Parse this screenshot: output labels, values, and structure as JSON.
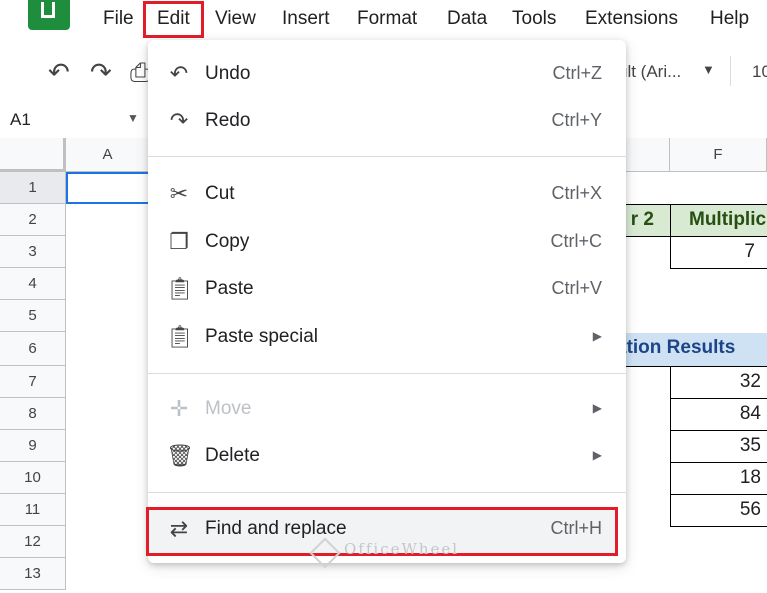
{
  "menubar": {
    "items": [
      "File",
      "Edit",
      "View",
      "Insert",
      "Format",
      "Data",
      "Tools",
      "Extensions",
      "Help"
    ]
  },
  "toolbar": {
    "font": "ult (Ari...",
    "font_size": "10"
  },
  "namebox": {
    "value": "A1"
  },
  "columns": [
    "A",
    "F"
  ],
  "rows": [
    "1",
    "2",
    "3",
    "4",
    "5",
    "6",
    "7",
    "8",
    "9",
    "10",
    "11",
    "12",
    "13"
  ],
  "sheet": {
    "header_partial_1": "r 2",
    "header_partial_2": "Multiplic",
    "row3_value": "7",
    "results_header": "ation Results",
    "results": [
      "32",
      "84",
      "35",
      "18",
      "56"
    ]
  },
  "edit_menu": {
    "items": [
      {
        "label": "Undo",
        "shortcut": "Ctrl+Z",
        "icon": "undo-icon"
      },
      {
        "label": "Redo",
        "shortcut": "Ctrl+Y",
        "icon": "redo-icon"
      },
      {
        "label": "Cut",
        "shortcut": "Ctrl+X",
        "icon": "scissors-icon"
      },
      {
        "label": "Copy",
        "shortcut": "Ctrl+C",
        "icon": "copy-icon"
      },
      {
        "label": "Paste",
        "shortcut": "Ctrl+V",
        "icon": "clipboard-icon"
      },
      {
        "label": "Paste special",
        "shortcut": "",
        "icon": "clipboard-icon"
      },
      {
        "label": "Move",
        "shortcut": "",
        "icon": "move-icon"
      },
      {
        "label": "Delete",
        "shortcut": "",
        "icon": "trash-icon"
      },
      {
        "label": "Find and replace",
        "shortcut": "Ctrl+H",
        "icon": "find-replace-icon"
      }
    ]
  },
  "watermark": "OfficeWheel",
  "colors": {
    "highlight_red": "#e11d2a",
    "selection_blue": "#1a73e8",
    "header_green": "#d9ead3",
    "header_blue": "#cfe2f3"
  }
}
